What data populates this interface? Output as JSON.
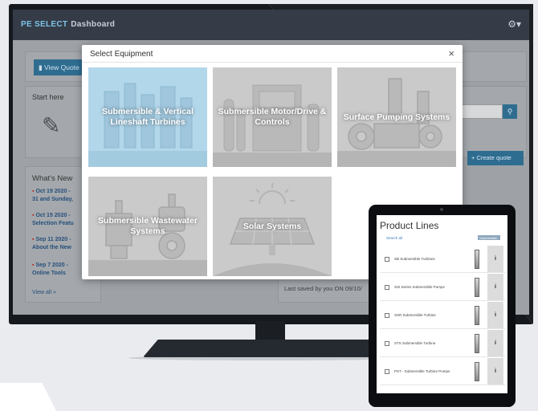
{
  "app": {
    "logo": "PE SELECT",
    "title": "Dashboard",
    "settings_icon": "⚙▾"
  },
  "dashboard": {
    "view_quote_label": "View Quote",
    "start_here_label": "Start here",
    "whats_new_title": "What's New",
    "news": [
      {
        "line1": "Oct 19 2020 -",
        "line2": "31 and Sunday,"
      },
      {
        "line1": "Oct 15 2020 -",
        "line2": "Selection Featu"
      },
      {
        "line1": "Sep 11 2020 -",
        "line2": "About the New"
      },
      {
        "line1": "Sep 7 2020 -",
        "line2": "Online Tools"
      }
    ],
    "view_all_label": "View all »",
    "create_quote_label": "+ Create quote",
    "last_saved_text": "Last saved by you ON 09/10/"
  },
  "modal": {
    "title": "Select Equipment",
    "close_glyph": "×",
    "tiles": [
      {
        "label": "Submersible & Vertical Lineshaft Turbines",
        "active": true
      },
      {
        "label": "Submersible Motor/Drive & Controls",
        "active": false
      },
      {
        "label": "Surface Pumping Systems",
        "active": false
      },
      {
        "label": "Submersible Wastewater Systems",
        "active": false
      },
      {
        "label": "Solar Systems",
        "active": false
      }
    ]
  },
  "tablet": {
    "title": "Product Lines",
    "search_label": "Search all",
    "dropdown_label": "Submersible",
    "info_glyph": "i",
    "products": [
      {
        "label": "SB Submersible Turbines"
      },
      {
        "label": "SSI Series Submersible Pumps"
      },
      {
        "label": "SSR Submersible Turbine"
      },
      {
        "label": "STS Submersible Turbine"
      },
      {
        "label": "PST - Submersible Turbine Pumps"
      }
    ]
  },
  "colors": {
    "accent": "#2f6d90",
    "active_tile": "#b3d7ea",
    "tile": "#cacaca",
    "topbar": "#353c48"
  }
}
